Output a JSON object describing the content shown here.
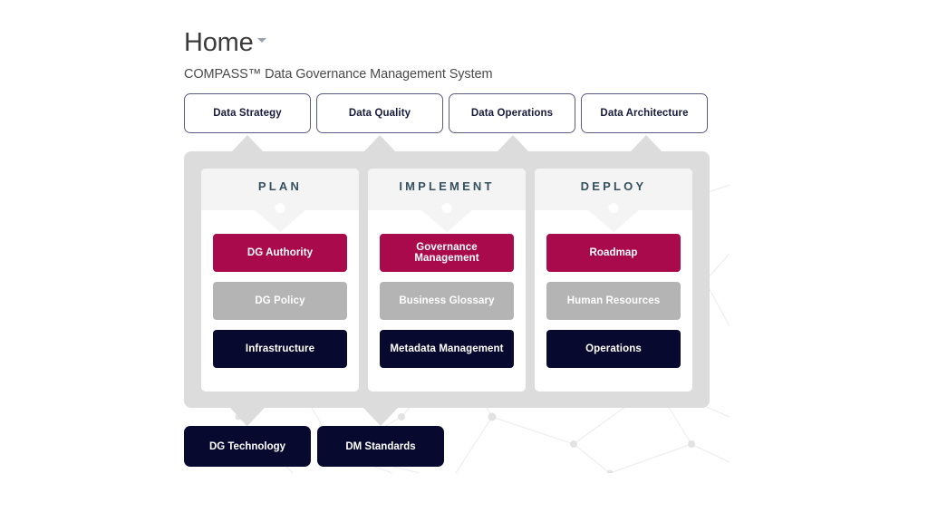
{
  "header": {
    "title": "Home",
    "title_caret_icon": "chevron-down-icon",
    "subtitle": "COMPASS™ Data Governance Management System"
  },
  "top_nav": {
    "items": [
      {
        "label": "Data Strategy"
      },
      {
        "label": "Data Quality"
      },
      {
        "label": "Data Operations"
      },
      {
        "label": "Data Architecture"
      }
    ]
  },
  "matrix": {
    "columns": [
      {
        "header": "PLAN",
        "items": [
          {
            "label": "DG Authority",
            "tier": "primary"
          },
          {
            "label": "DG Policy",
            "tier": "muted"
          },
          {
            "label": "Infrastructure",
            "tier": "dark"
          }
        ]
      },
      {
        "header": "IMPLEMENT",
        "items": [
          {
            "label": "Governance Management",
            "tier": "primary"
          },
          {
            "label": "Business Glossary",
            "tier": "muted"
          },
          {
            "label": "Metadata Management",
            "tier": "dark"
          }
        ]
      },
      {
        "header": "DEPLOY",
        "items": [
          {
            "label": "Roadmap",
            "tier": "primary"
          },
          {
            "label": "Human Resources",
            "tier": "muted"
          },
          {
            "label": "Operations",
            "tier": "dark"
          }
        ]
      }
    ]
  },
  "bottom_nav": {
    "items": [
      {
        "label": "DG Technology"
      },
      {
        "label": "DM Standards"
      }
    ]
  },
  "colors": {
    "crimson": "#a90a4c",
    "navy": "#070a2e",
    "gray": "#b4b4b4",
    "container_gray": "#dcdcdc",
    "header_band": "#f4f4f4",
    "nav_border": "#5b5b80",
    "column_header_text": "#35505f",
    "page_background": "#ffffff"
  }
}
